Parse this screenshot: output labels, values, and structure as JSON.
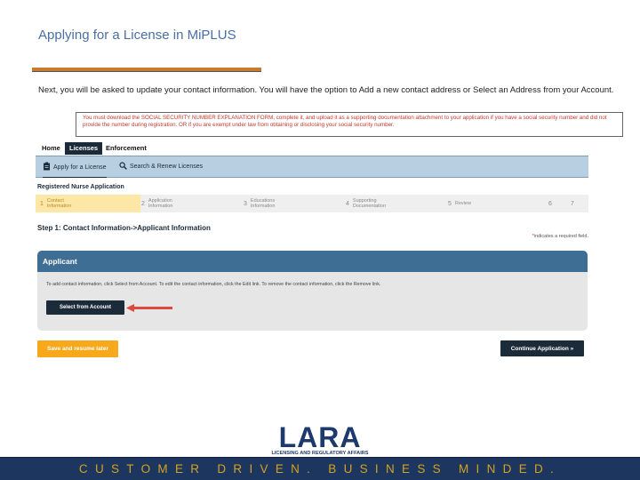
{
  "slide": {
    "title": "Applying for a License in MiPLUS",
    "instruction": "Next, you will be asked to update your contact information.  You will have the option to Add a new contact address or Select an Address from your Account."
  },
  "app": {
    "warning": "You must download the SOCIAL SECURITY NUMBER EXPLANATION FORM, complete it, and upload it as a supporting documentation attachment to your application if you have a social security number and did not provide the number during registration. OR if you are exempt under law from obtaining or disclosing your social security number.",
    "top_nav": [
      "Home",
      "Licenses",
      "Enforcement"
    ],
    "sub_nav": {
      "apply": "Apply for a License",
      "search": "Search & Renew Licenses"
    },
    "application_name": "Registered Nurse Application",
    "steps": [
      {
        "num": "1",
        "label_1": "Contact",
        "label_2": "Information"
      },
      {
        "num": "2",
        "label_1": "Application",
        "label_2": "Information"
      },
      {
        "num": "3",
        "label_1": "Educations",
        "label_2": "Information"
      },
      {
        "num": "4",
        "label_1": "Supporting",
        "label_2": "Documentation"
      },
      {
        "num": "5",
        "label_1": "Review",
        "label_2": ""
      },
      {
        "num": "6",
        "label_1": "",
        "label_2": ""
      },
      {
        "num": "7",
        "label_1": "",
        "label_2": ""
      }
    ],
    "step_heading": "Step 1: Contact Information->Applicant Information",
    "required_note": "indicates a required field.",
    "panel": {
      "title": "Applicant",
      "text": "To add contact information, click Select from Account. To edit the contact information, click the Edit link. To remove the contact information, click the Remove link.",
      "select_button": "Select from Account"
    },
    "save_button": "Save and resume later",
    "continue_button": "Continue Application »"
  },
  "branding": {
    "logo_text": "LARA",
    "logo_subtext": "LICENSING AND REGULATORY AFFAIRS",
    "footer_slogan": "CUSTOMER DRIVEN. BUSINESS MINDED."
  },
  "colors": {
    "brand_navy": "#1c3660",
    "footer_gold": "#d4a21e",
    "title_blue": "#4a6fa5",
    "accent_orange": "#c87a2e",
    "warning_red": "#c0392b",
    "save_orange": "#f7a81b",
    "arrow_red": "#e0483e"
  },
  "icons": {
    "apply": "clipboard-icon",
    "search": "search-icon",
    "arrow": "left-arrow-icon"
  }
}
